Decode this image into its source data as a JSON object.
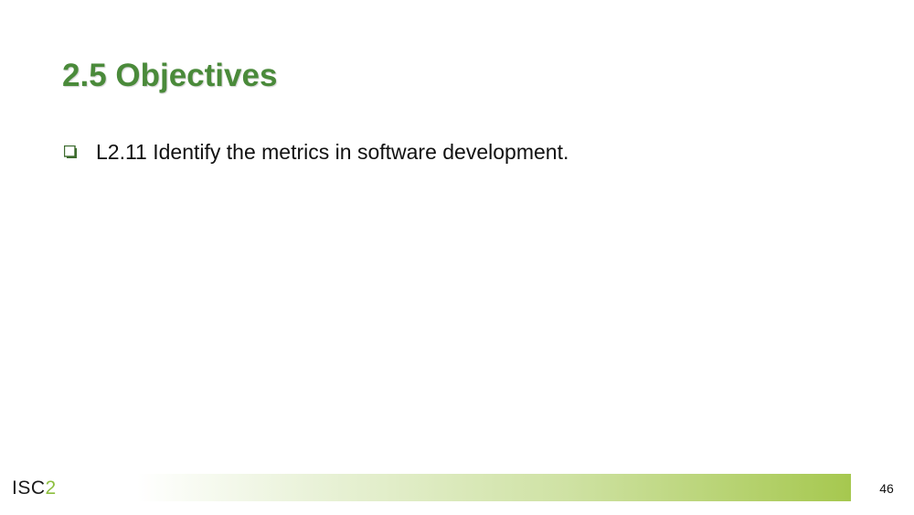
{
  "slide": {
    "title": "2.5 Objectives",
    "title_color": "#4a8a3a",
    "objectives": [
      {
        "icon": "checkbox-square-icon",
        "text": "L2.11 Identify the metrics in software development."
      }
    ]
  },
  "footer": {
    "logo_text": "ISC",
    "logo_accent": "2",
    "bar_gradient_end_color": "#a6c84f",
    "page_number": "46"
  }
}
